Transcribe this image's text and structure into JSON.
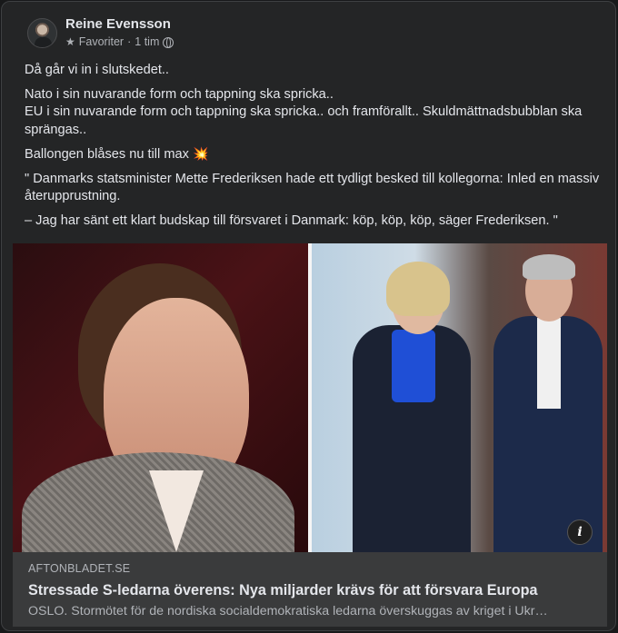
{
  "post": {
    "author": "Reine Evensson",
    "audience_label": "Favoriter",
    "separator": "·",
    "time": "1 tim",
    "paragraphs": [
      "Då går vi in i slutskedet..",
      "Nato i sin nuvarande form och tappning ska spricka..",
      "EU i sin nuvarande form och tappning ska spricka.. och framförallt.. Skuldmättnadsbubblan ska sprängas..",
      "Ballongen blåses nu till max",
      "\" Danmarks statsminister Mette Frederiksen hade ett tydligt besked till kollegorna: Inled en massiv återupprustning.",
      "– Jag har sänt ett klart budskap till försvaret i Danmark: köp, köp, köp, säger Frederiksen. \""
    ],
    "emoji": "💥"
  },
  "icons": {
    "star": "star-icon",
    "globe": "globe-icon",
    "info": "info-icon",
    "star_glyph": "★",
    "info_glyph": "i"
  },
  "link_preview": {
    "domain": "AFTONBLADET.SE",
    "headline": "Stressade S-ledarna överens: Nya miljarder krävs för att försvara Europa",
    "description": "OSLO. Stormötet för de nordiska socialdemokratiska ledarna överskuggas av kriget i Ukr…"
  },
  "colors": {
    "card_bg": "#242526",
    "text": "#e4e6eb",
    "secondary_text": "#b0b3b8",
    "link_bg": "#3a3b3c"
  }
}
